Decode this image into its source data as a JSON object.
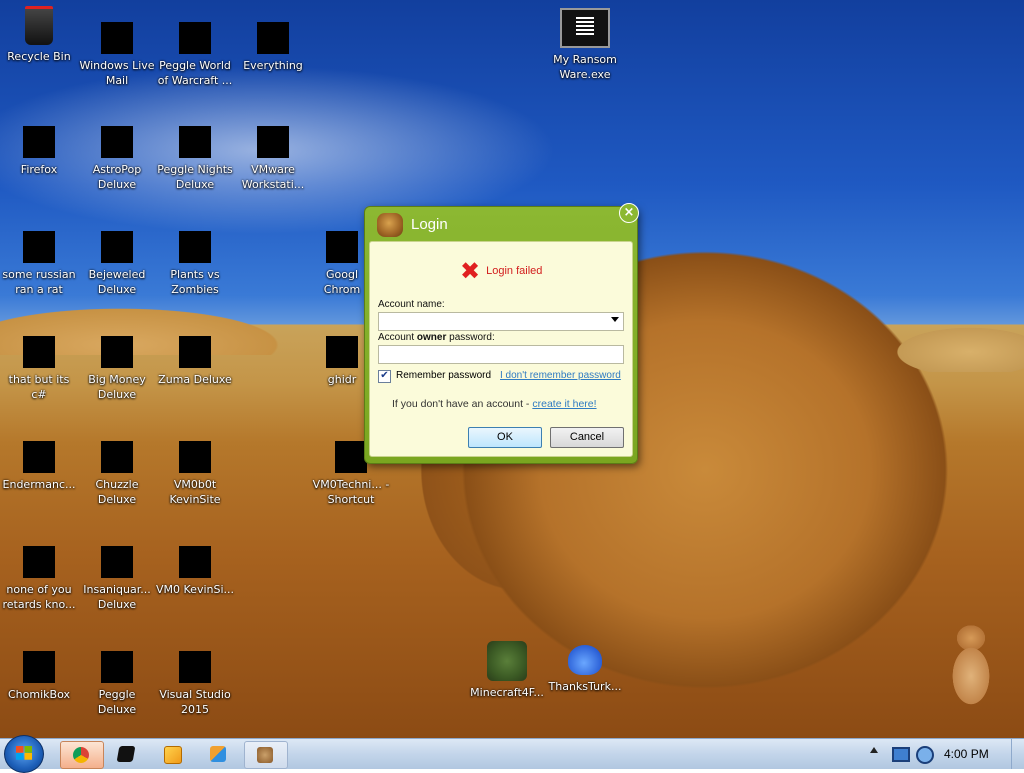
{
  "desktop": {
    "icons": [
      {
        "label": "Recycle Bin",
        "icon": "recycle-bin-icon"
      },
      {
        "label": "Windows Live Mail",
        "icon": "redacted-icon"
      },
      {
        "label": "Peggle World of Warcraft ...",
        "icon": "redacted-icon"
      },
      {
        "label": "Everything",
        "icon": "redacted-icon"
      },
      {
        "label": "My Ransom Ware.exe",
        "icon": "terminal-icon"
      },
      {
        "label": "Firefox",
        "icon": "redacted-icon"
      },
      {
        "label": "AstroPop Deluxe",
        "icon": "redacted-icon"
      },
      {
        "label": "Peggle Nights Deluxe",
        "icon": "redacted-icon"
      },
      {
        "label": "VMware Workstati...",
        "icon": "redacted-icon"
      },
      {
        "label": "some russian ran a rat",
        "icon": "redacted-icon"
      },
      {
        "label": "Bejeweled Deluxe",
        "icon": "redacted-icon"
      },
      {
        "label": "Plants vs Zombies",
        "icon": "redacted-icon"
      },
      {
        "label": "Googl Chrom",
        "icon": "redacted-icon"
      },
      {
        "label": "that but its c#",
        "icon": "redacted-icon"
      },
      {
        "label": "Big Money Deluxe",
        "icon": "redacted-icon"
      },
      {
        "label": "Zuma Deluxe",
        "icon": "redacted-icon"
      },
      {
        "label": "ghidr",
        "icon": "redacted-icon"
      },
      {
        "label": "Endermanc...",
        "icon": "redacted-icon"
      },
      {
        "label": "Chuzzle Deluxe",
        "icon": "redacted-icon"
      },
      {
        "label": "VM0b0t KevinSite",
        "icon": "redacted-icon"
      },
      {
        "label": "VM0Techni... - Shortcut",
        "icon": "redacted-icon"
      },
      {
        "label": "none of you retards kno...",
        "icon": "redacted-icon"
      },
      {
        "label": "Insaniquar... Deluxe",
        "icon": "redacted-icon"
      },
      {
        "label": "VM0 KevinSi...",
        "icon": "redacted-icon"
      },
      {
        "label": "ChomikBox",
        "icon": "redacted-icon"
      },
      {
        "label": "Peggle Deluxe",
        "icon": "redacted-icon"
      },
      {
        "label": "Visual Studio 2015",
        "icon": "redacted-icon"
      },
      {
        "label": "Minecraft4F...",
        "icon": "minecraft-block-icon"
      },
      {
        "label": "ThanksTurk...",
        "icon": "blue-creature-icon"
      }
    ]
  },
  "dialog": {
    "title": "Login",
    "close_glyph": "×",
    "error_glyph": "✖",
    "error_message": "Login failed",
    "account_name_label": "Account name:",
    "password_label_prefix": "Account ",
    "password_label_bold": "owner",
    "password_label_suffix": " password:",
    "account_name_value": "",
    "password_value": "",
    "remember_label": "Remember password",
    "remember_checked": true,
    "check_glyph": "✔",
    "forgot_link": "I don't remember password",
    "no_account_text": "If you don't have an account - ",
    "create_link": "create it here!",
    "ok_label": "OK",
    "cancel_label": "Cancel",
    "accent_color": "#8cb832"
  },
  "taskbar": {
    "clock": "4:00 PM",
    "items": [
      {
        "name": "chrome-taskbar-button",
        "icon": "chrome-icon",
        "state": "active"
      },
      {
        "name": "terminal-taskbar-button",
        "icon": "terminal-icon",
        "state": "normal"
      },
      {
        "name": "media-player-taskbar-button",
        "icon": "media-player-icon",
        "state": "normal"
      },
      {
        "name": "explorer-taskbar-button",
        "icon": "explorer-icon",
        "state": "normal"
      },
      {
        "name": "chomikbox-taskbar-button",
        "icon": "chomikbox-icon",
        "state": "pinned"
      }
    ]
  }
}
